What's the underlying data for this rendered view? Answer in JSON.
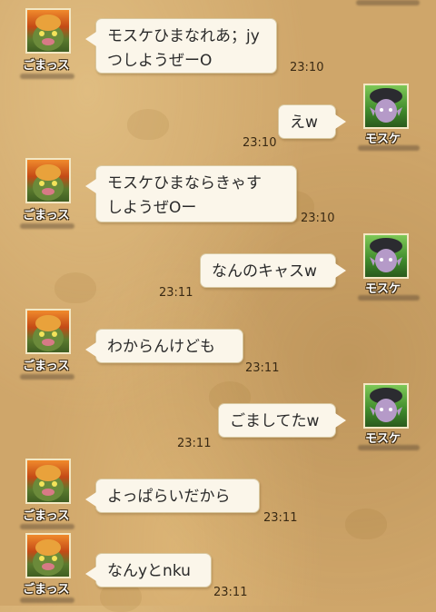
{
  "chat": {
    "messages": [
      {
        "sender": "ごまっス",
        "text": "モスケひまなれあ；jy\nつしようぜーO",
        "time": "23:10"
      },
      {
        "sender": "モスケ",
        "text": "えw",
        "time": "23:10"
      },
      {
        "sender": "ごまっス",
        "text": "モスケひまならきゃす\nしようぜOー",
        "time": "23:10"
      },
      {
        "sender": "モスケ",
        "text": "なんのキャスw",
        "time": "23:11"
      },
      {
        "sender": "ごまっス",
        "text": "わからんけども",
        "time": "23:11"
      },
      {
        "sender": "モスケ",
        "text": "ごましてたw",
        "time": "23:11"
      },
      {
        "sender": "ごまっス",
        "text": "よっぱらいだから",
        "time": "23:11"
      },
      {
        "sender": "ごまっス",
        "text": "なんyとnku",
        "time": "23:11"
      }
    ]
  },
  "avatars": {
    "gorilla": "gorilla-monster-avatar-icon",
    "mosuke": "hooded-elf-avatar-icon"
  }
}
